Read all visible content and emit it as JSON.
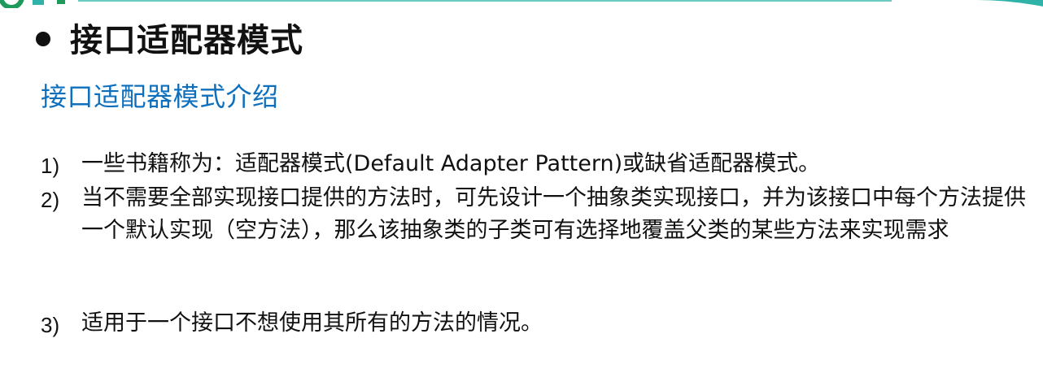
{
  "slide": {
    "heading": "接口适配器模式",
    "subheading": "接口适配器模式介绍",
    "items": [
      {
        "number": "1)",
        "text": "一些书籍称为：适配器模式(Default Adapter Pattern)或缺省适配器模式。"
      },
      {
        "number": "2)",
        "text": "当不需要全部实现接口提供的方法时，可先设计一个抽象类实现接口，并为该接口中每个方法提供一个默认实现（空方法），那么该抽象类的子类可有选择地覆盖父类的某些方法来实现需求"
      },
      {
        "number": "3)",
        "text": "适用于一个接口不想使用其所有的方法的情况。"
      }
    ]
  },
  "colors": {
    "subheading": "#0e6fbd",
    "band_green": "#1f9a5a",
    "band_teal": "#2fb3a8"
  }
}
